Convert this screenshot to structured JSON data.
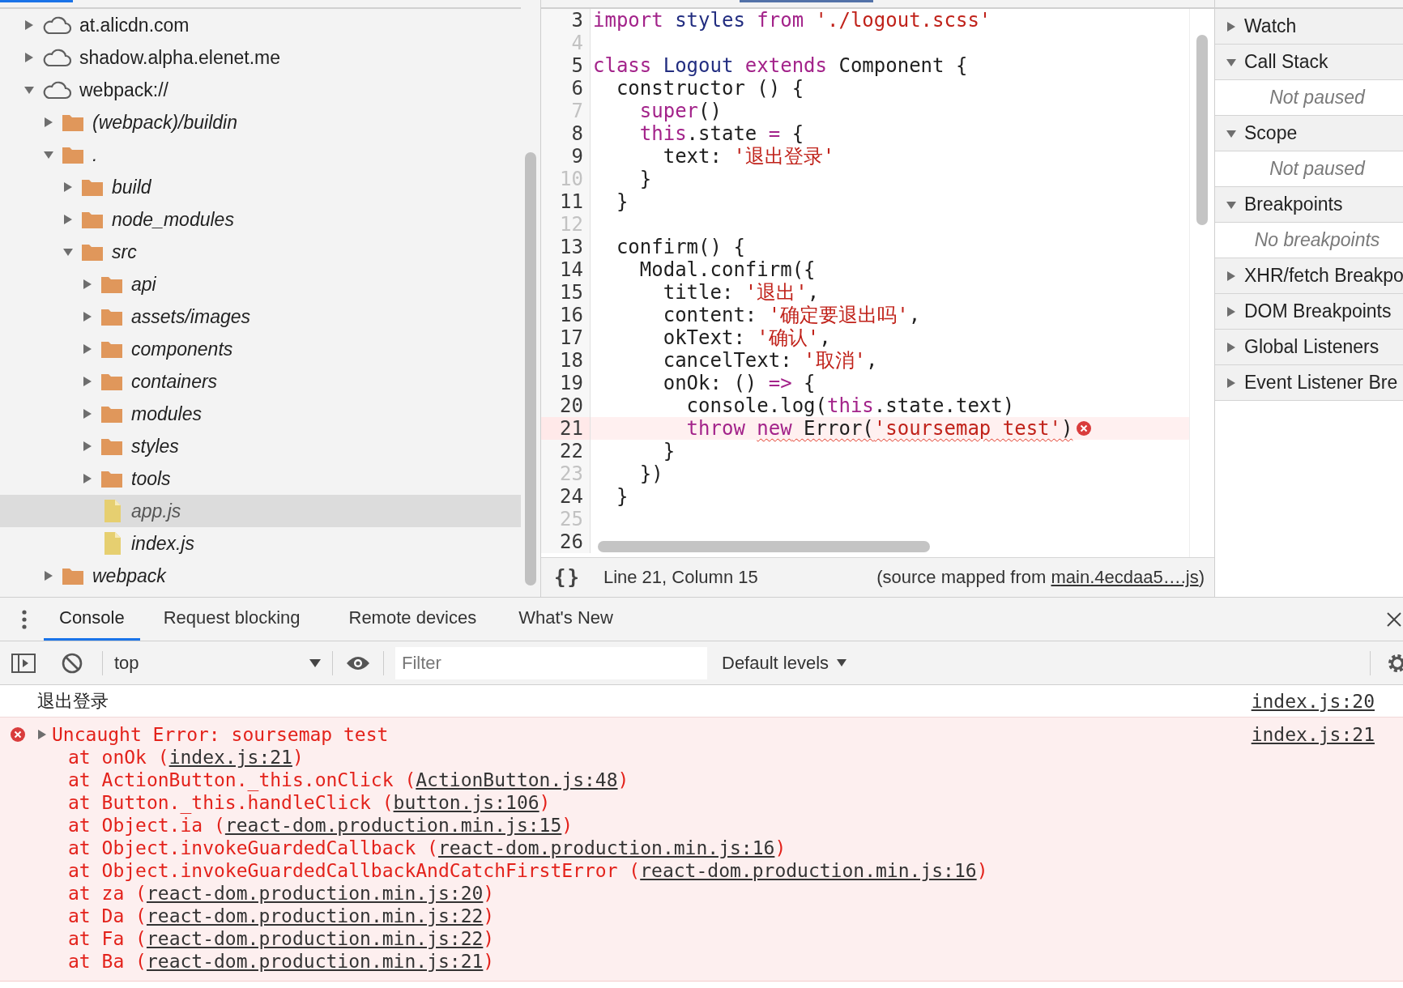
{
  "navigator": {
    "tree": [
      {
        "kind": "domain",
        "label": "at.alicdn.com",
        "expanded": false,
        "selected": false
      },
      {
        "kind": "domain",
        "label": "shadow.alpha.elenet.me",
        "expanded": false,
        "selected": false
      },
      {
        "kind": "domain",
        "label": "webpack://",
        "expanded": true,
        "selected": false,
        "children": [
          {
            "kind": "folder",
            "label": "(webpack)/buildin",
            "expanded": false,
            "selected": false
          },
          {
            "kind": "folder",
            "label": ".",
            "expanded": true,
            "selected": false,
            "children": [
              {
                "kind": "folder",
                "label": "build",
                "expanded": false,
                "selected": false
              },
              {
                "kind": "folder",
                "label": "node_modules",
                "expanded": false,
                "selected": false
              },
              {
                "kind": "folder",
                "label": "src",
                "expanded": true,
                "selected": false,
                "children": [
                  {
                    "kind": "folder",
                    "label": "api",
                    "expanded": false,
                    "selected": false
                  },
                  {
                    "kind": "folder",
                    "label": "assets/images",
                    "expanded": false,
                    "selected": false
                  },
                  {
                    "kind": "folder",
                    "label": "components",
                    "expanded": false,
                    "selected": false
                  },
                  {
                    "kind": "folder",
                    "label": "containers",
                    "expanded": false,
                    "selected": false
                  },
                  {
                    "kind": "folder",
                    "label": "modules",
                    "expanded": false,
                    "selected": false
                  },
                  {
                    "kind": "folder",
                    "label": "styles",
                    "expanded": false,
                    "selected": false
                  },
                  {
                    "kind": "folder",
                    "label": "tools",
                    "expanded": false,
                    "selected": false
                  },
                  {
                    "kind": "file",
                    "label": "app.js",
                    "selected": true
                  },
                  {
                    "kind": "file",
                    "label": "index.js",
                    "selected": false
                  }
                ]
              }
            ]
          },
          {
            "kind": "folder",
            "label": "webpack",
            "expanded": false,
            "selected": false
          }
        ]
      }
    ]
  },
  "editor": {
    "lines": [
      {
        "number": "3",
        "mapped": true,
        "tokens": [
          {
            "kind": "keyword",
            "text": "import "
          },
          {
            "kind": "def",
            "text": "styles "
          },
          {
            "kind": "keyword",
            "text": "from "
          },
          {
            "kind": "string",
            "text": "'./logout.scss'"
          }
        ]
      },
      {
        "number": "4",
        "mapped": false
      },
      {
        "number": "5",
        "mapped": true,
        "tokens": [
          {
            "kind": "keyword",
            "text": "class "
          },
          {
            "kind": "def",
            "text": "Logout "
          },
          {
            "kind": "keyword",
            "text": "extends "
          },
          {
            "kind": "plain",
            "text": "Component {"
          }
        ]
      },
      {
        "number": "6",
        "mapped": true,
        "tokens": [
          {
            "kind": "plain",
            "text": "  constructor () {"
          }
        ]
      },
      {
        "number": "7",
        "mapped": false,
        "tokens": [
          {
            "kind": "keyword",
            "text": "    super"
          },
          {
            "kind": "plain",
            "text": "()"
          }
        ]
      },
      {
        "number": "8",
        "mapped": true,
        "tokens": [
          {
            "kind": "keyword",
            "text": "    this"
          },
          {
            "kind": "plain",
            "text": ".state "
          },
          {
            "kind": "keyword",
            "text": "= "
          },
          {
            "kind": "plain",
            "text": "{"
          }
        ]
      },
      {
        "number": "9",
        "mapped": true,
        "tokens": [
          {
            "kind": "plain",
            "text": "      text: "
          },
          {
            "kind": "string",
            "text": "'退出登录'"
          }
        ]
      },
      {
        "number": "10",
        "mapped": false,
        "tokens": [
          {
            "kind": "plain",
            "text": "    }"
          }
        ]
      },
      {
        "number": "11",
        "mapped": true,
        "tokens": [
          {
            "kind": "plain",
            "text": "  }"
          }
        ]
      },
      {
        "number": "12",
        "mapped": false
      },
      {
        "number": "13",
        "mapped": true,
        "tokens": [
          {
            "kind": "plain",
            "text": "  confirm() {"
          }
        ]
      },
      {
        "number": "14",
        "mapped": true,
        "tokens": [
          {
            "kind": "plain",
            "text": "    Modal.confirm({"
          }
        ]
      },
      {
        "number": "15",
        "mapped": true,
        "tokens": [
          {
            "kind": "plain",
            "text": "      title: "
          },
          {
            "kind": "string",
            "text": "'退出'"
          },
          {
            "kind": "plain",
            "text": ","
          }
        ]
      },
      {
        "number": "16",
        "mapped": true,
        "tokens": [
          {
            "kind": "plain",
            "text": "      content: "
          },
          {
            "kind": "string",
            "text": "'确定要退出吗'"
          },
          {
            "kind": "plain",
            "text": ","
          }
        ]
      },
      {
        "number": "17",
        "mapped": true,
        "tokens": [
          {
            "kind": "plain",
            "text": "      okText: "
          },
          {
            "kind": "string",
            "text": "'确认'"
          },
          {
            "kind": "plain",
            "text": ","
          }
        ]
      },
      {
        "number": "18",
        "mapped": true,
        "tokens": [
          {
            "kind": "plain",
            "text": "      cancelText: "
          },
          {
            "kind": "string",
            "text": "'取消'"
          },
          {
            "kind": "plain",
            "text": ","
          }
        ]
      },
      {
        "number": "19",
        "mapped": true,
        "tokens": [
          {
            "kind": "plain",
            "text": "      onOk: () "
          },
          {
            "kind": "keyword",
            "text": "=> "
          },
          {
            "kind": "plain",
            "text": "{"
          }
        ]
      },
      {
        "number": "20",
        "mapped": true,
        "tokens": [
          {
            "kind": "plain",
            "text": "        console.log("
          },
          {
            "kind": "keyword",
            "text": "this"
          },
          {
            "kind": "plain",
            "text": ".state.text)"
          }
        ]
      },
      {
        "number": "21",
        "mapped": true,
        "error": true,
        "tokens": [
          {
            "kind": "keyword",
            "text": "        throw "
          },
          {
            "kind": "keyword",
            "text": "new",
            "underlined": true
          },
          {
            "kind": "plain",
            "text": " Error(",
            "underlined": true
          },
          {
            "kind": "string",
            "text": "'soursemap test'",
            "underlined": true
          },
          {
            "kind": "plain",
            "text": ")",
            "underlined": true
          }
        ]
      },
      {
        "number": "22",
        "mapped": true,
        "tokens": [
          {
            "kind": "plain",
            "text": "      }"
          }
        ]
      },
      {
        "number": "23",
        "mapped": false,
        "tokens": [
          {
            "kind": "plain",
            "text": "    })"
          }
        ]
      },
      {
        "number": "24",
        "mapped": true,
        "tokens": [
          {
            "kind": "plain",
            "text": "  }"
          }
        ]
      },
      {
        "number": "25",
        "mapped": false
      },
      {
        "number": "26",
        "mapped": true
      }
    ],
    "status_bar": {
      "pretty_print": "{}",
      "cursor": "Line 21, Column 15",
      "source_prefix": "(source mapped from ",
      "source_link": "main.4ecdaa5….js",
      "source_suffix": ")"
    }
  },
  "debugger": {
    "sections": [
      {
        "title": "Watch",
        "expanded": false
      },
      {
        "title": "Call Stack",
        "expanded": true,
        "body": "Not paused"
      },
      {
        "title": "Scope",
        "expanded": true,
        "body": "Not paused"
      },
      {
        "title": "Breakpoints",
        "expanded": true,
        "body": "No breakpoints"
      },
      {
        "title": "XHR/fetch Breakpo",
        "expanded": false
      },
      {
        "title": "DOM Breakpoints",
        "expanded": false
      },
      {
        "title": "Global Listeners",
        "expanded": false
      },
      {
        "title": "Event Listener Bre",
        "expanded": false
      }
    ]
  },
  "drawer": {
    "tabs": [
      {
        "label": "Console",
        "selected": true
      },
      {
        "label": "Request blocking",
        "selected": false
      },
      {
        "label": "Remote devices",
        "selected": false
      },
      {
        "label": "What's New",
        "selected": false
      }
    ]
  },
  "console": {
    "context": "top",
    "filter": {
      "placeholder": "Filter"
    },
    "levels": "Default levels",
    "messages": [
      {
        "kind": "log",
        "text": "退出登录",
        "source": "index.js:20"
      },
      {
        "kind": "error",
        "expanded": false,
        "text": "Uncaught Error: soursemap test",
        "source": "index.js:21",
        "stack": [
          {
            "prefix": "at onOk (",
            "link": "index.js:21",
            "suffix": ")"
          },
          {
            "prefix": "at ActionButton._this.onClick (",
            "link": "ActionButton.js:48",
            "suffix": ")"
          },
          {
            "prefix": "at Button._this.handleClick (",
            "link": "button.js:106",
            "suffix": ")"
          },
          {
            "prefix": "at Object.ia (",
            "link": "react-dom.production.min.js:15",
            "suffix": ")"
          },
          {
            "prefix": "at Object.invokeGuardedCallback (",
            "link": "react-dom.production.min.js:16",
            "suffix": ")"
          },
          {
            "prefix": "at Object.invokeGuardedCallbackAndCatchFirstError (",
            "link": "react-dom.production.min.js:16",
            "suffix": ")"
          },
          {
            "prefix": "at za (",
            "link": "react-dom.production.min.js:20",
            "suffix": ")"
          },
          {
            "prefix": "at Da (",
            "link": "react-dom.production.min.js:22",
            "suffix": ")"
          },
          {
            "prefix": "at Fa (",
            "link": "react-dom.production.min.js:22",
            "suffix": ")"
          },
          {
            "prefix": "at Ba (",
            "link": "react-dom.production.min.js:21",
            "suffix": ")"
          }
        ]
      }
    ]
  }
}
